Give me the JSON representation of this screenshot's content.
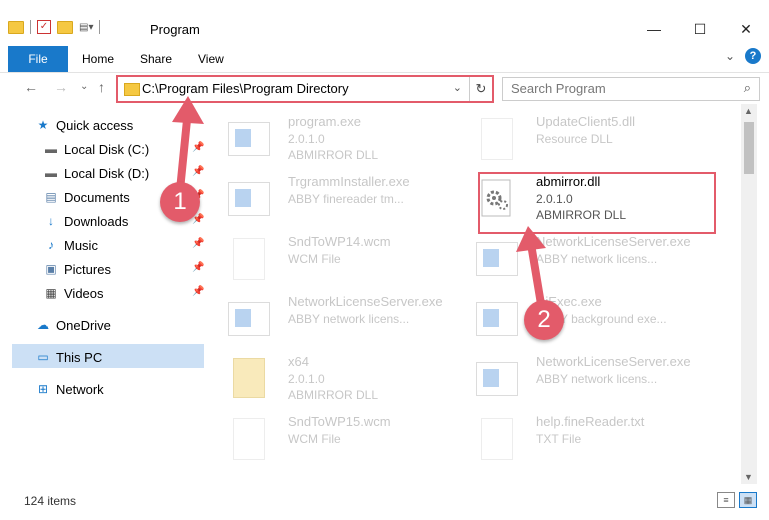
{
  "window": {
    "title": "Program",
    "minimize": "—",
    "maximize": "☐",
    "close": "✕"
  },
  "ribbon": {
    "tabs": [
      "File",
      "Home",
      "Share",
      "View"
    ],
    "expand": "⌄",
    "help": "?"
  },
  "nav": {
    "back": "←",
    "forward": "→",
    "recent": "⌄",
    "up": "↑",
    "address": "C:\\Program Files\\Program Directory",
    "address_dropdown": "⌄",
    "refresh": "↻",
    "search_placeholder": "Search Program",
    "search_icon": "⌕"
  },
  "sidebar": {
    "items": [
      {
        "label": "Quick access",
        "icon": "★"
      },
      {
        "label": "Local Disk (C:)",
        "icon": "▬"
      },
      {
        "label": "Local Disk (D:)",
        "icon": "▬"
      },
      {
        "label": "Documents",
        "icon": "▤"
      },
      {
        "label": "Downloads",
        "icon": "↓"
      },
      {
        "label": "Music",
        "icon": "♪"
      },
      {
        "label": "Pictures",
        "icon": "▣"
      },
      {
        "label": "Videos",
        "icon": "▦"
      },
      {
        "label": "OneDrive",
        "icon": "☁"
      },
      {
        "label": "This PC",
        "icon": "▭"
      },
      {
        "label": "Network",
        "icon": "⊞"
      }
    ],
    "pin_icon": "📌"
  },
  "files": [
    {
      "name": "program.exe",
      "line1": "2.0.1.0",
      "line2": "ABMIRROR DLL"
    },
    {
      "name": "UpdateClient5.dll",
      "line1": "Resource DLL",
      "line2": ""
    },
    {
      "name": "TrgrammInstaller.exe",
      "line1": "ABBY finereader tm...",
      "line2": ""
    },
    {
      "name": "abmirror.dll",
      "line1": "2.0.1.0",
      "line2": "ABMIRROR DLL"
    },
    {
      "name": "SndToWP14.wcm",
      "line1": "WCM File",
      "line2": ""
    },
    {
      "name": "NetworkLicenseServer.exe",
      "line1": "ABBY network licens...",
      "line2": ""
    },
    {
      "name": "NetworkLicenseServer.exe",
      "line1": "ABBY network licens...",
      "line2": ""
    },
    {
      "name": "DiExec.exe",
      "line1": "ABBY background exe...",
      "line2": ""
    },
    {
      "name": "x64",
      "line1": "2.0.1.0",
      "line2": "ABMIRROR DLL"
    },
    {
      "name": "NetworkLicenseServer.exe",
      "line1": "ABBY network licens...",
      "line2": ""
    },
    {
      "name": "SndToWP15.wcm",
      "line1": "WCM File",
      "line2": ""
    },
    {
      "name": "help.fineReader.txt",
      "line1": "TXT File",
      "line2": ""
    }
  ],
  "status": {
    "item_count": "124 items"
  },
  "callouts": [
    "1",
    "2"
  ]
}
